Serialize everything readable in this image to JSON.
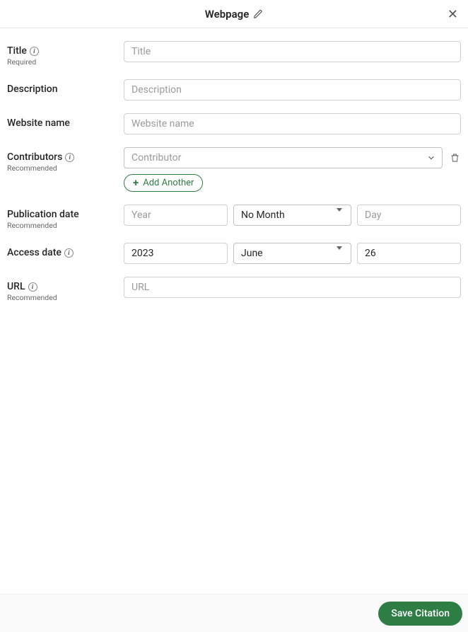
{
  "header": {
    "title": "Webpage"
  },
  "labels": {
    "title": "Title",
    "title_sub": "Required",
    "description": "Description",
    "website_name": "Website name",
    "contributors": "Contributors",
    "contributors_sub": "Recommended",
    "publication_date": "Publication date",
    "publication_date_sub": "Recommended",
    "access_date": "Access date",
    "url": "URL",
    "url_sub": "Recommended"
  },
  "placeholders": {
    "title": "Title",
    "description": "Description",
    "website_name": "Website name",
    "contributor": "Contributor",
    "year": "Year",
    "day": "Day",
    "url": "URL"
  },
  "values": {
    "pub_month": "No Month",
    "access_year": "2023",
    "access_month": "June",
    "access_day": "26"
  },
  "buttons": {
    "add_another": "Add Another",
    "save": "Save Citation"
  }
}
